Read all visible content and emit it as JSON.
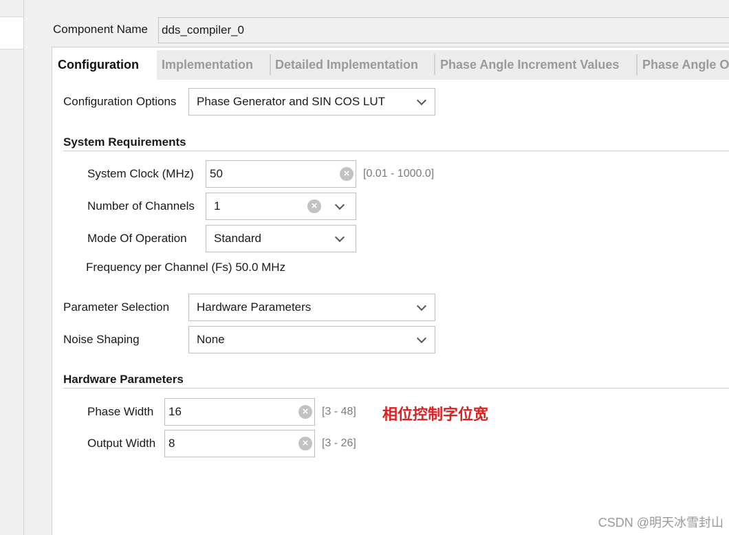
{
  "component": {
    "label": "Component Name",
    "value": "dds_compiler_0"
  },
  "tabs": [
    "Configuration",
    "Implementation",
    "Detailed Implementation",
    "Phase Angle Increment Values",
    "Phase Angle O"
  ],
  "config_options": {
    "label": "Configuration Options",
    "value": "Phase Generator and SIN COS LUT"
  },
  "system_requirements": {
    "heading": "System Requirements",
    "clock": {
      "label": "System Clock (MHz)",
      "value": "50",
      "range": "[0.01 - 1000.0]"
    },
    "channels": {
      "label": "Number of Channels",
      "value": "1"
    },
    "mode": {
      "label": "Mode Of Operation",
      "value": "Standard"
    },
    "frequency_text": "Frequency per Channel (Fs) 50.0 MHz"
  },
  "parameter_selection": {
    "label": "Parameter Selection",
    "value": "Hardware Parameters"
  },
  "noise_shaping": {
    "label": "Noise Shaping",
    "value": "None"
  },
  "hardware_parameters": {
    "heading": "Hardware Parameters",
    "phase_width": {
      "label": "Phase Width",
      "value": "16",
      "range": "[3 - 48]"
    },
    "output_width": {
      "label": "Output Width",
      "value": "8",
      "range": "[3 - 26]"
    }
  },
  "annotation": "相位控制字位宽",
  "watermark": "CSDN @明天冰雪封山",
  "icons": {
    "clear": "clear-icon",
    "dropdown": "chevron-down-icon"
  },
  "colors": {
    "annotation": "#e02020",
    "tab_inactive": "#9a9a9a"
  }
}
